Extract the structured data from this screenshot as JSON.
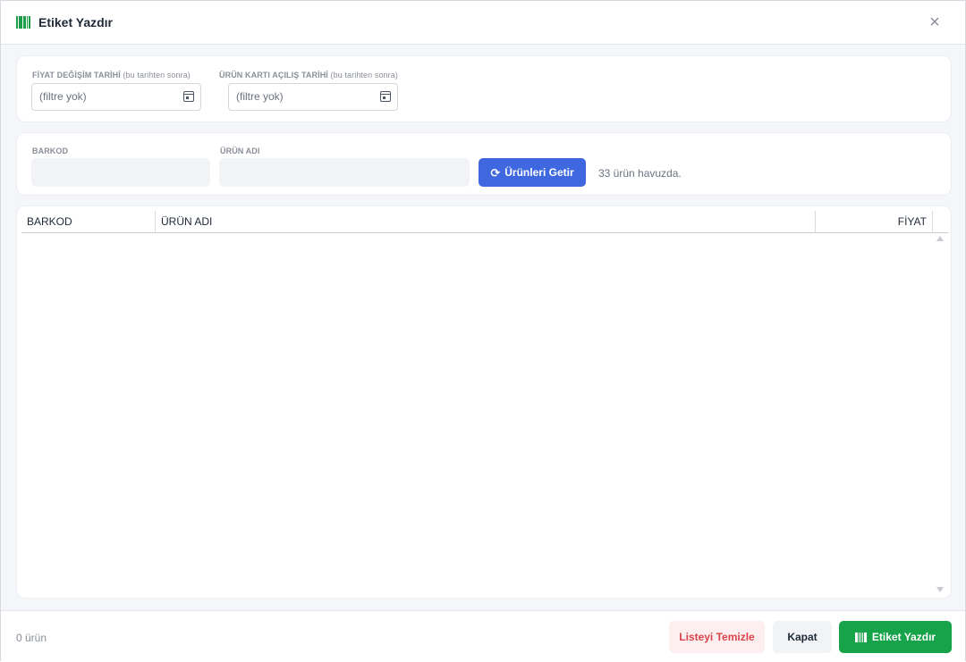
{
  "dialog": {
    "title": "Etiket Yazdır",
    "icon": "barcode-icon",
    "close_symbol": "×",
    "accent": "#1e9e4a"
  },
  "filters": {
    "price_change_label": "FİYAT DEĞİŞİM TARİHİ",
    "price_change_sub": "(bu tarihten sonra)",
    "price_change_value": "(filtre yok)",
    "card_open_label": "ÜRÜN KARTI AÇILIŞ TARİHİ",
    "card_open_sub": "(bu tarihten sonra)",
    "card_open_value": "(filtre yok)"
  },
  "search": {
    "barcode_label": "BARKOD",
    "barcode_value": "",
    "name_label": "ÜRÜN ADI",
    "name_value": "",
    "fetch_button": "Ürünleri Getir",
    "pool_status": "33 ürün havuzda."
  },
  "table": {
    "columns": [
      "BARKOD",
      "ÜRÜN ADI",
      "FİYAT"
    ],
    "rows": []
  },
  "footer": {
    "count": "0 ürün",
    "clear_button": "Listeyi Temizle",
    "close_button": "Kapat",
    "print_button": "Etiket Yazdır",
    "primary_color": "#17a34a",
    "danger_color": "#d8434c",
    "fetch_color": "#3f68e0"
  }
}
